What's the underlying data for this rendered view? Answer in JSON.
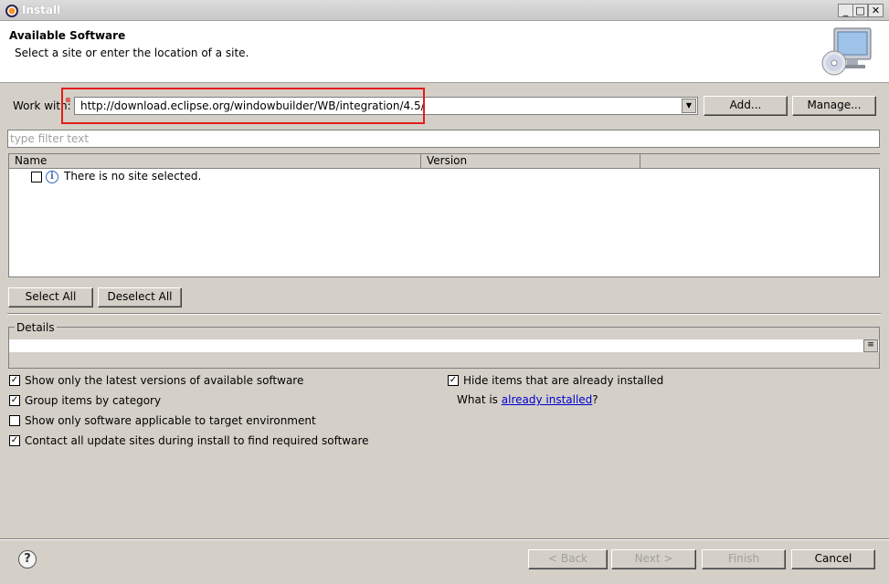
{
  "window": {
    "title": "Install",
    "minimize_symbol": "_",
    "maximize_symbol": "□",
    "close_symbol": "✕"
  },
  "header": {
    "title": "Available Software",
    "subtitle": "Select a site or enter the location of a site."
  },
  "work_with": {
    "label": "Work with:",
    "value": "http://download.eclipse.org/windowbuilder/WB/integration/4.5/",
    "add_label": "Add...",
    "manage_label": "Manage..."
  },
  "filter": {
    "placeholder": "type filter text"
  },
  "tree": {
    "columns": [
      "Name",
      "Version"
    ],
    "rows": [
      {
        "name": "There is no site selected.",
        "checked": false
      }
    ]
  },
  "selection": {
    "select_all_label": "Select All",
    "deselect_all_label": "Deselect All"
  },
  "details": {
    "label": "Details"
  },
  "options": {
    "latest_versions": {
      "label": "Show only the latest versions of available software",
      "checked": true
    },
    "group_by_category": {
      "label": "Group items by category",
      "checked": true
    },
    "target_env": {
      "label": "Show only software applicable to target environment",
      "checked": false
    },
    "contact_sites": {
      "label": "Contact all update sites during install to find required software",
      "checked": true
    },
    "hide_installed": {
      "label": "Hide items that are already installed",
      "checked": true
    },
    "what_is_prefix": "What is ",
    "already_installed_link": "already installed",
    "what_is_suffix": "?"
  },
  "footer": {
    "back_label": "< Back",
    "next_label": "Next >",
    "finish_label": "Finish",
    "cancel_label": "Cancel",
    "help_symbol": "?"
  },
  "icons": {
    "window": "eclipse-icon",
    "header": "install-cd-monitor-icon",
    "error": "error-icon",
    "info": "info-icon",
    "help": "help-icon"
  }
}
